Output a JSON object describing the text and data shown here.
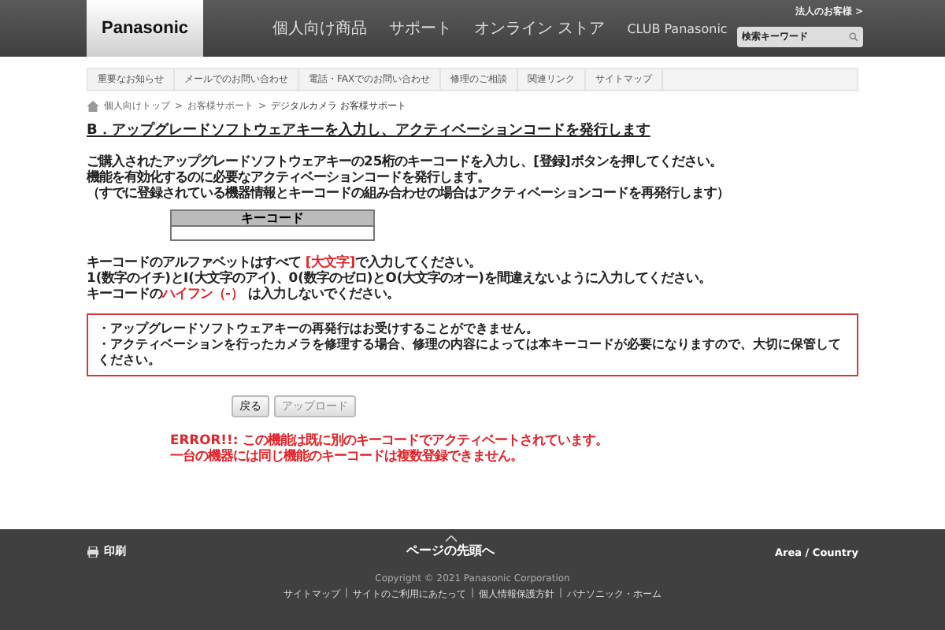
{
  "header": {
    "logo": "Panasonic",
    "nav": [
      "個人向け商品",
      "サポート",
      "オンライン ストア",
      "CLUB Panasonic"
    ],
    "corporate_link": "法人のお客様 >",
    "search": {
      "placeholder": "検索キーワード"
    }
  },
  "subnav": [
    "重要なお知らせ",
    "メールでのお問い合わせ",
    "電話・FAXでのお問い合わせ",
    "修理のご相談",
    "関連リンク",
    "サイトマップ"
  ],
  "breadcrumb": [
    "個人向けトップ",
    "お客様サポート",
    "デジタルカメラ お客様サポート"
  ],
  "breadcrumb_separators": [
    ">",
    ">"
  ],
  "heading": "B．アップグレードソフトウェアキーを入力し、アクティベーションコードを発行します",
  "intro": [
    "ご購入されたアップグレードソフトウェアキーの25桁のキーコードを入力し、[登録]ボタンを押してください。",
    "機能を有効化するのに必要なアクティベーションコードを発行します。",
    "（すでに登録されている機器情報とキーコードの組み合わせの場合はアクティベーションコードを再発行します）"
  ],
  "key_table": {
    "header": "キーコード"
  },
  "notes": [
    [
      {
        "text": "キーコードのアルファベットはすべて ",
        "highlight": false
      },
      {
        "text": "[大文字]",
        "highlight": true
      },
      {
        "text": "で入力してください。",
        "highlight": false
      }
    ],
    [
      {
        "text": "1(数字のイチ)とI(大文字のアイ)、0(数字のゼロ)とO(大文字のオー)を間違えないように入力してください。",
        "highlight": false
      }
    ],
    [
      {
        "text": "キーコードの",
        "highlight": false
      },
      {
        "text": "ハイフン（-）",
        "highlight": true
      },
      {
        "text": " は入力しないでください。",
        "highlight": false
      }
    ]
  ],
  "warnings": [
    "・アップグレードソフトウェアキーの再発行はお受けすることができません。",
    "・アクティベーションを行ったカメラを修理する場合、修理の内容によっては本キーコードが必要になりますので、大切に保管してください。"
  ],
  "buttons": [
    {
      "label": "戻る",
      "disabled": false
    },
    {
      "label": "アップロード",
      "disabled": true
    }
  ],
  "error": [
    "ERROR!!: この機能は既に別のキーコードでアクティベートされています。",
    "一台の機器には同じ機能のキーコードは複数登録できません。"
  ],
  "footer": {
    "print": "印刷",
    "page_top": "ページの先頭へ",
    "region": "Area / Country",
    "copyright": "Copyright © 2021 Panasonic Corporation",
    "links": [
      "サイトマップ",
      "サイトのご利用にあたって",
      "個人情報保護方針",
      "パナソニック・ホーム"
    ],
    "link_separators": [
      "|",
      "|",
      "|"
    ]
  }
}
